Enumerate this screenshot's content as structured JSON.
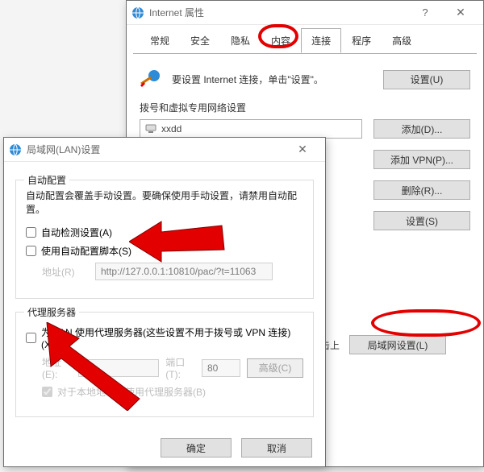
{
  "internetProps": {
    "title": "Internet 属性",
    "tabs": [
      "常规",
      "安全",
      "隐私",
      "内容",
      "连接",
      "程序",
      "高级"
    ],
    "activeTabIndex": 4,
    "hint": "要设置 Internet 连接，单击\"设置\"。",
    "setupBtn": "设置(U)",
    "dialupLabel": "拨号和虚拟专用网络设置",
    "dialupItem": "xxdd",
    "addBtn": "添加(D)...",
    "addVpnBtn": "添加 VPN(P)...",
    "removeBtn": "删除(R)...",
    "settingsBtn": "设置(S)",
    "lanHint": "击上",
    "lanSettingsBtn": "局域网设置(L)"
  },
  "lanDlg": {
    "title": "局域网(LAN)设置",
    "autoCfg": {
      "legend": "自动配置",
      "note": "自动配置会覆盖手动设置。要确保使用手动设置，请禁用自动配置。",
      "autoDetect": "自动检测设置(A)",
      "useScript": "使用自动配置脚本(S)",
      "addrLabel": "地址(R)",
      "addrValue": "http://127.0.0.1:10810/pac/?t=11063"
    },
    "proxy": {
      "legend": "代理服务器",
      "useProxy": "为 LAN 使用代理服务器(这些设置不用于拨号或 VPN 连接)(X)",
      "addrLabel": "地址(E):",
      "addrValue": "",
      "portLabel": "端口(T):",
      "portValue": "80",
      "advBtn": "高级(C)",
      "bypass": "对于本地地址不使用代理服务器(B)"
    },
    "ok": "确定",
    "cancel": "取消"
  }
}
